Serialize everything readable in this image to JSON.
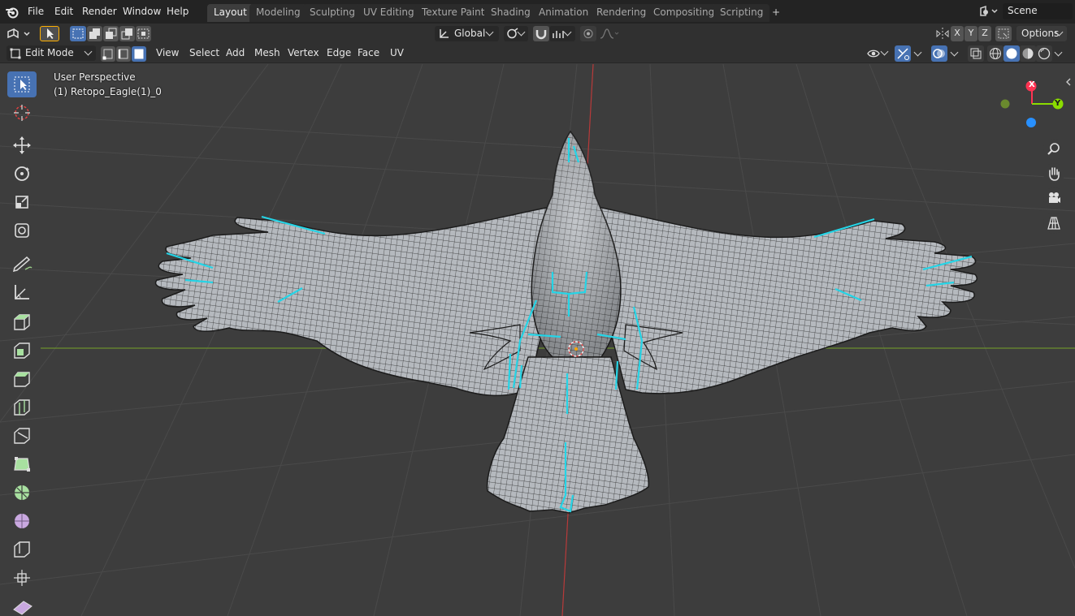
{
  "menubar": {
    "items": [
      "File",
      "Edit",
      "Render",
      "Window",
      "Help"
    ]
  },
  "workspaces": {
    "tabs": [
      "Layout",
      "Modeling",
      "Sculpting",
      "UV Editing",
      "Texture Paint",
      "Shading",
      "Animation",
      "Rendering",
      "Compositing",
      "Scripting"
    ],
    "active": "Layout",
    "add_label": "+"
  },
  "scene": {
    "name": "Scene"
  },
  "header1": {
    "transform_orientation": "Global",
    "axis_x": "X",
    "axis_y": "Y",
    "axis_z": "Z",
    "options_label": "Options"
  },
  "header2": {
    "mode": "Edit Mode",
    "menus": [
      "View",
      "Select",
      "Add",
      "Mesh",
      "Vertex",
      "Edge",
      "Face",
      "UV"
    ]
  },
  "viewport": {
    "perspective_label": "User Perspective",
    "object_label": "(1) Retopo_Eagle(1)_0"
  },
  "gizmo": {
    "x_label": "X",
    "y_label": "Y",
    "x_color": "#ff3352",
    "y_color": "#8bdc00",
    "z_color": "#2890ff"
  },
  "colors": {
    "accent": "#4772b3",
    "seam": "#25d4e6",
    "mesh": "#b9bdc2",
    "wire": "#1a1a1a"
  }
}
